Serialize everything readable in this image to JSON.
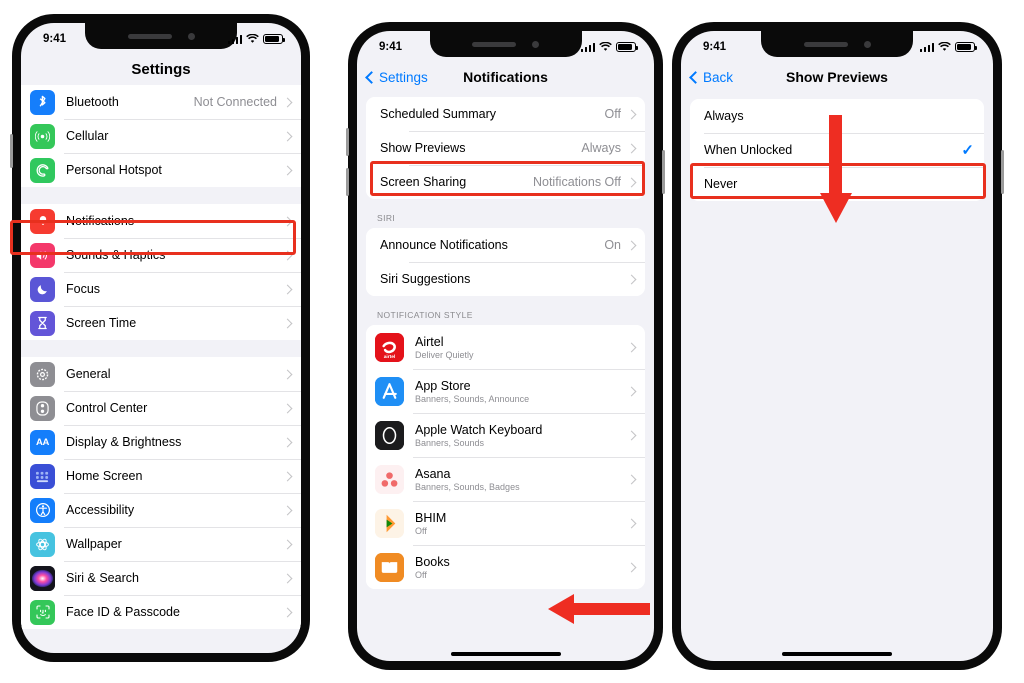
{
  "statusbar": {
    "time": "9:41",
    "signal_icon": "cellular-bars-icon",
    "wifi_icon": "wifi-icon",
    "battery_icon": "battery-icon"
  },
  "phone1": {
    "nav": {
      "title": "Settings"
    },
    "groups": [
      {
        "rows": [
          {
            "icon": "bluetooth-icon",
            "label": "Bluetooth",
            "value": "Not Connected"
          },
          {
            "icon": "cellular-icon",
            "label": "Cellular",
            "value": ""
          },
          {
            "icon": "personal-hotspot-icon",
            "label": "Personal Hotspot",
            "value": ""
          }
        ]
      },
      {
        "rows": [
          {
            "icon": "notifications-icon",
            "label": "Notifications",
            "value": ""
          },
          {
            "icon": "sounds-haptics-icon",
            "label": "Sounds & Haptics",
            "value": ""
          },
          {
            "icon": "focus-icon",
            "label": "Focus",
            "value": ""
          },
          {
            "icon": "screen-time-icon",
            "label": "Screen Time",
            "value": ""
          }
        ]
      },
      {
        "rows": [
          {
            "icon": "general-icon",
            "label": "General",
            "value": ""
          },
          {
            "icon": "control-center-icon",
            "label": "Control Center",
            "value": ""
          },
          {
            "icon": "display-brightness-icon",
            "label": "Display & Brightness",
            "value": ""
          },
          {
            "icon": "home-screen-icon",
            "label": "Home Screen",
            "value": ""
          },
          {
            "icon": "accessibility-icon",
            "label": "Accessibility",
            "value": ""
          },
          {
            "icon": "wallpaper-icon",
            "label": "Wallpaper",
            "value": ""
          },
          {
            "icon": "siri-search-icon",
            "label": "Siri & Search",
            "value": ""
          },
          {
            "icon": "face-id-icon",
            "label": "Face ID & Passcode",
            "value": ""
          }
        ]
      }
    ]
  },
  "phone2": {
    "nav": {
      "back_label": "Settings",
      "title": "Notifications"
    },
    "group1": [
      {
        "label": "Scheduled Summary",
        "value": "Off"
      },
      {
        "label": "Show Previews",
        "value": "Always"
      },
      {
        "label": "Screen Sharing",
        "value": "Notifications Off"
      }
    ],
    "siri_header": "SIRI",
    "group2": [
      {
        "label": "Announce Notifications",
        "value": "On"
      },
      {
        "label": "Siri Suggestions",
        "value": ""
      }
    ],
    "style_header": "NOTIFICATION STYLE",
    "apps": [
      {
        "icon": "airtel-icon",
        "name": "Airtel",
        "detail": "Deliver Quietly"
      },
      {
        "icon": "app-store-icon",
        "name": "App Store",
        "detail": "Banners, Sounds, Announce"
      },
      {
        "icon": "apple-watch-keyboard-icon",
        "name": "Apple Watch Keyboard",
        "detail": "Banners, Sounds"
      },
      {
        "icon": "asana-icon",
        "name": "Asana",
        "detail": "Banners, Sounds, Badges"
      },
      {
        "icon": "bhim-icon",
        "name": "BHIM",
        "detail": "Off"
      },
      {
        "icon": "books-icon",
        "name": "Books",
        "detail": "Off"
      }
    ]
  },
  "phone3": {
    "nav": {
      "back_label": "Back",
      "title": "Show Previews"
    },
    "options": [
      {
        "label": "Always",
        "selected": false
      },
      {
        "label": "When Unlocked",
        "selected": true
      },
      {
        "label": "Never",
        "selected": false
      }
    ],
    "checkmark": "✓"
  },
  "annotations": {
    "accent_red": "#e8301e",
    "highlight1": "notifications-row-highlight",
    "highlight2": "show-previews-row-highlight",
    "highlight3": "when-unlocked-row-highlight",
    "arrow_left": "left-pointing-arrow",
    "arrow_down": "down-pointing-arrow"
  }
}
